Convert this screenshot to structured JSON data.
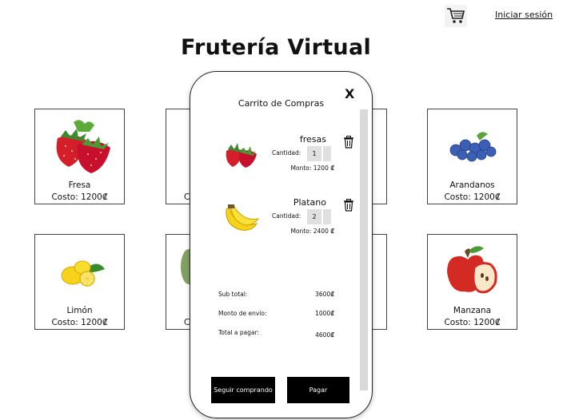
{
  "header": {
    "cart_icon": "shopping-cart-icon",
    "login_label": "Iniciar sesión"
  },
  "page": {
    "title": "Frutería Virtual"
  },
  "products": [
    {
      "name": "Fresa",
      "cost": "Costo: 1200₡",
      "icon": "strawberry"
    },
    {
      "name": "Arandanos",
      "cost": "Costo: 1200₡",
      "icon": "blueberries"
    },
    {
      "name": "Limón",
      "cost": "Costo: 1200₡",
      "icon": "lemon"
    },
    {
      "name": "Manzana",
      "cost": "Costo: 1200₡",
      "icon": "apple"
    }
  ],
  "partial_labels": [
    "C",
    "C"
  ],
  "cart": {
    "title": "Carrito de Compras",
    "close_label": "X",
    "items": [
      {
        "name": "fresas",
        "quantity_label": "Cantidad:",
        "quantity": "1",
        "amount": "Monto: 1200 ₡",
        "icon": "strawberry"
      },
      {
        "name": "Platano",
        "quantity_label": "Cantidad:",
        "quantity": "2",
        "amount": "Monto: 2400 ₡",
        "icon": "banana"
      }
    ],
    "summary": {
      "subtotal_label": "Sub total:",
      "subtotal_value": "3600₡",
      "shipping_label": "Monto de envío:",
      "shipping_value": "1000₡",
      "total_label": "Total a pagar:",
      "total_value": "4600₡"
    },
    "continue_label": "Seguir comprando",
    "pay_label": "Pagar"
  }
}
